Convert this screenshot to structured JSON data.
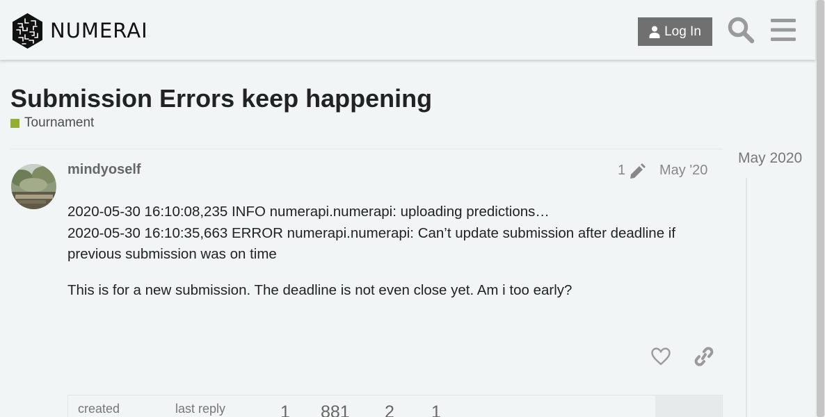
{
  "header": {
    "logo_text": "NUMERAI",
    "login_label": "Log In"
  },
  "topic": {
    "title": "Submission Errors keep happening",
    "category": "Tournament",
    "category_color": "#91b12e"
  },
  "post": {
    "username": "mindyoself",
    "edit_count": "1",
    "date": "May '20",
    "paragraphs": [
      "2020-05-30 16:10:08,235 INFO numerapi.numerapi: uploading predictions…",
      "2020-05-30 16:10:35,663 ERROR numerapi.numerapi: Can’t update submission after deadline if previous submission was on time",
      "This is for a new submission. The deadline is not even close yet. Am i too early?"
    ]
  },
  "topic_map": {
    "created_label": "created",
    "last_reply_label": "last reply",
    "stats": [
      "1",
      "881",
      "2",
      "1"
    ]
  },
  "timeline": {
    "date": "May 2020"
  },
  "colors": {
    "background": "#f2f5f5",
    "login_button": "#707070",
    "category": "#91b12e"
  },
  "icons": {
    "logo": "numerai-logo-icon",
    "login": "user-icon",
    "search": "search-icon",
    "menu": "hamburger-menu-icon",
    "edit": "pencil-icon",
    "like": "heart-icon",
    "share": "link-icon"
  }
}
